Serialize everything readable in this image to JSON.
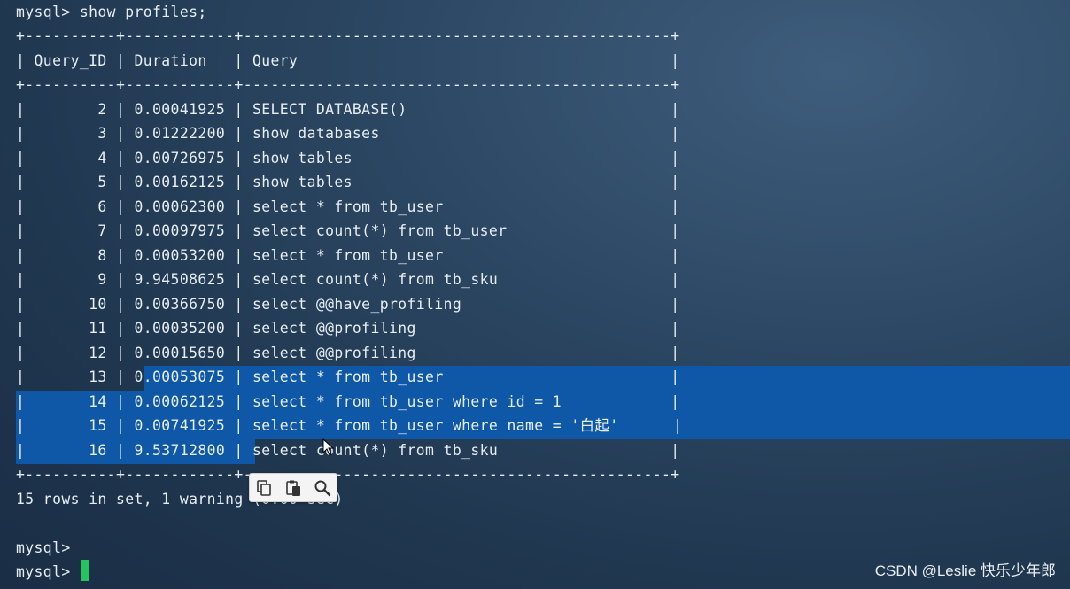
{
  "terminal": {
    "command_line": "mysql> show profiles;",
    "border": "+----------+------------+-----------------------------------------------+",
    "header_line": "| Query_ID | Duration   | Query                                         |",
    "rows": [
      {
        "line": "|        2 | 0.00041925 | SELECT DATABASE()                             |"
      },
      {
        "line": "|        3 | 0.01222200 | show databases                                |"
      },
      {
        "line": "|        4 | 0.00726975 | show tables                                   |"
      },
      {
        "line": "|        5 | 0.00162125 | show tables                                   |"
      },
      {
        "line": "|        6 | 0.00062300 | select * from tb_user                         |"
      },
      {
        "line": "|        7 | 0.00097975 | select count(*) from tb_user                  |"
      },
      {
        "line": "|        8 | 0.00053200 | select * from tb_user                         |"
      },
      {
        "line": "|        9 | 9.94508625 | select count(*) from tb_sku                   |"
      },
      {
        "line": "|       10 | 0.00366750 | select @@have_profiling                       |"
      },
      {
        "line": "|       11 | 0.00035200 | select @@profiling                            |"
      },
      {
        "line": "|       12 | 0.00015650 | select @@profiling                            |"
      },
      {
        "line": "|       13 | 0.00053075 | select * from tb_user                         |"
      },
      {
        "line": "|       14 | 0.00062125 | select * from tb_user where id = 1            |"
      },
      {
        "line": "|       15 | 0.00741925 | select * from tb_user where name = '白起'      |"
      },
      {
        "line": "|       16 | 9.53712800 | select count(*) from tb_sku                   |"
      }
    ],
    "result_line": "15 rows in set, 1 warning (0.00 sec)",
    "prompt1": "mysql>",
    "prompt2": "mysql>"
  },
  "selection_colors": {
    "highlight": "#0f58a8",
    "cursor": "#22c55e"
  },
  "toolbar": {
    "icons": [
      "copy-icon",
      "paste-icon",
      "search-icon"
    ]
  },
  "watermark": "CSDN @Leslie 快乐少年郎"
}
